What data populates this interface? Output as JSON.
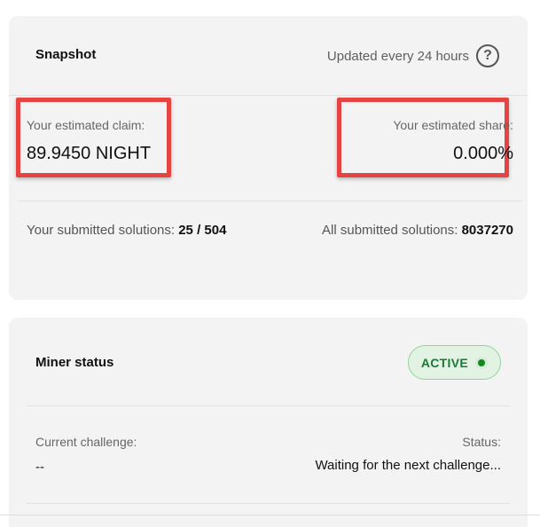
{
  "snapshot": {
    "title": "Snapshot",
    "updated_text": "Updated every 24 hours",
    "help_glyph": "?",
    "estimated_claim": {
      "label": "Your estimated claim:",
      "value": "89.9450 NIGHT"
    },
    "estimated_share": {
      "label": "Your estimated share:",
      "value": "0.000%"
    },
    "your_submitted": {
      "label": "Your submitted solutions:",
      "value": "25 / 504"
    },
    "all_submitted": {
      "label": "All submitted solutions:",
      "value": "8037270"
    }
  },
  "miner": {
    "title": "Miner status",
    "status_badge": "ACTIVE",
    "current_challenge": {
      "label": "Current challenge:",
      "value": "--"
    },
    "status": {
      "label": "Status:",
      "value": "Waiting for the next challenge..."
    }
  },
  "colors": {
    "highlight_border": "#e84343",
    "active_text": "#1b7a33",
    "active_bg": "#e2f3e4",
    "card_bg": "#f3f3f3"
  },
  "icons": {
    "help": "help-circle-icon",
    "status": "status-dot-icon"
  }
}
